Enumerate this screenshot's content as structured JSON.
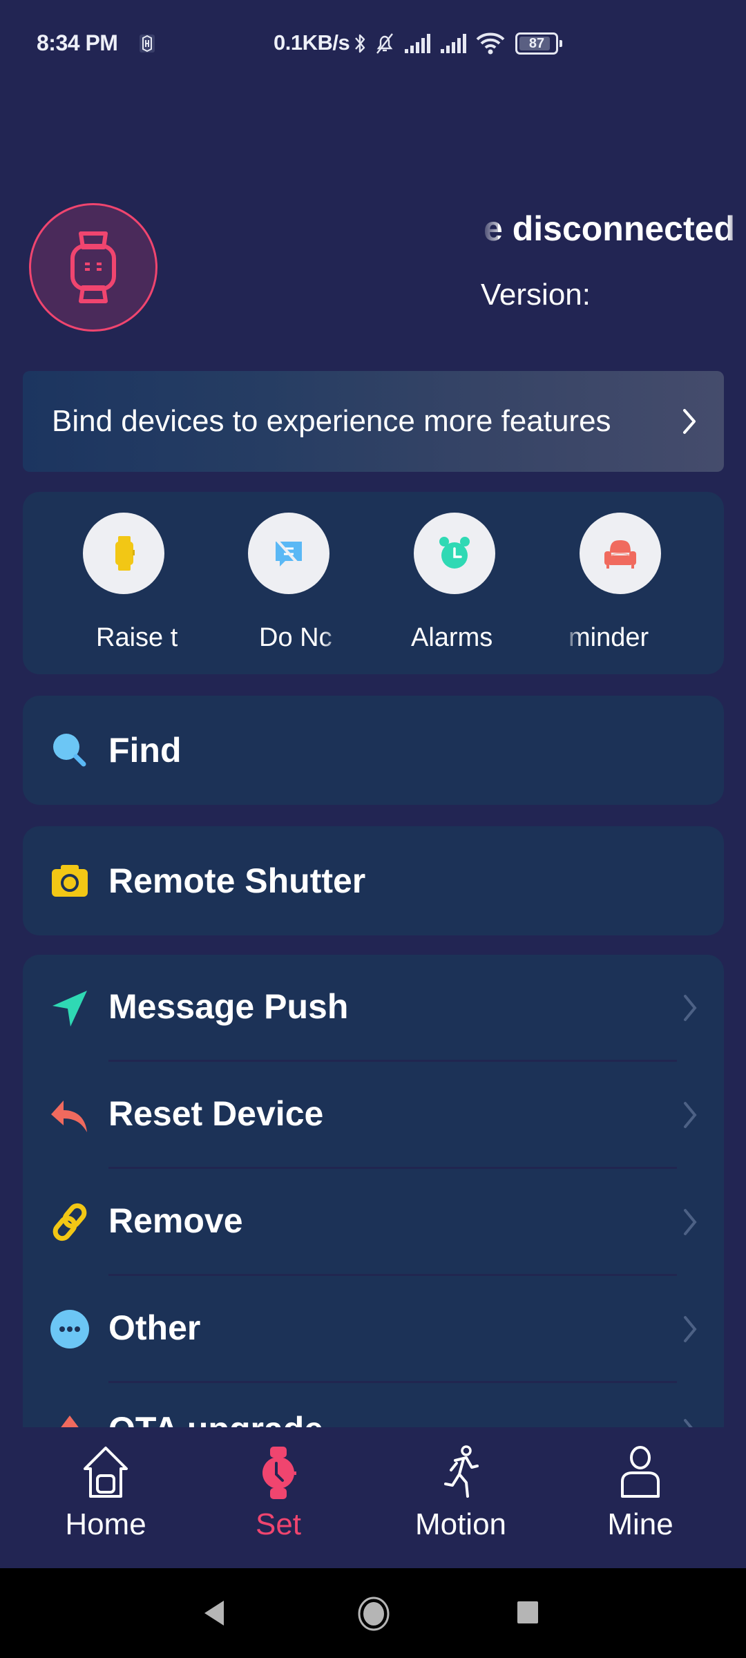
{
  "status_bar": {
    "time": "8:34 PM",
    "network_speed": "0.1KB/s",
    "battery_level": "87",
    "battery_percent": 87,
    "icons": [
      "hyper-app-icon",
      "bluetooth-icon",
      "bell-muted-icon",
      "signal-icon",
      "signal-icon",
      "wifi-icon",
      "battery-icon"
    ]
  },
  "device": {
    "avatar_icon": "smartwatch-icon",
    "status_visible": "e disconnected",
    "status_full": "Device disconnected",
    "version_label": "Version:"
  },
  "bind_banner": {
    "text": "Bind devices to experience more features",
    "chevron_icon": "chevron-right-icon"
  },
  "quick_features": [
    {
      "icon": "watch-raise-icon",
      "label_visible": "Raise t",
      "label_full": "Raise to wake",
      "color": "#f2c715"
    },
    {
      "icon": "do-not-disturb-icon",
      "label_visible": "Do Nc",
      "label_full": "Do Not Disturb",
      "color": "#5ab8f5"
    },
    {
      "icon": "alarm-clock-icon",
      "label_visible": "Alarms",
      "label_full": "Alarms",
      "color": "#2fd9b4"
    },
    {
      "icon": "sedentary-sofa-icon",
      "label_visible": "minder",
      "label_full": "Sedentary reminder",
      "color": "#f06a5e"
    }
  ],
  "actions": {
    "find": {
      "label": "Find",
      "icon": "search-icon"
    },
    "remote_shutter": {
      "label": "Remote Shutter",
      "icon": "camera-icon"
    }
  },
  "settings_list": [
    {
      "label": "Message Push",
      "icon": "send-icon",
      "color": "#2fd9b4"
    },
    {
      "label": "Reset Device",
      "icon": "reset-arrow-icon",
      "color": "#f06a5e"
    },
    {
      "label": "Remove",
      "icon": "link-icon",
      "color": "#f2c715"
    },
    {
      "label": "Other",
      "icon": "more-icon",
      "color": "#6cc6f5"
    },
    {
      "label": "OTA upgrade",
      "icon": "upgrade-icon",
      "color": "#f06a5e"
    }
  ],
  "bottom_nav": {
    "items": [
      {
        "label": "Home",
        "icon": "home-icon",
        "active": false
      },
      {
        "label": "Set",
        "icon": "watch-icon",
        "active": true
      },
      {
        "label": "Motion",
        "icon": "running-icon",
        "active": false
      },
      {
        "label": "Mine",
        "icon": "person-icon",
        "active": false
      }
    ]
  },
  "system_nav": [
    "back-button",
    "home-button",
    "recents-button"
  ],
  "colors": {
    "background": "#222553",
    "card": "#1c3257",
    "accent": "#f0456f",
    "chevron": "#4d6185"
  }
}
